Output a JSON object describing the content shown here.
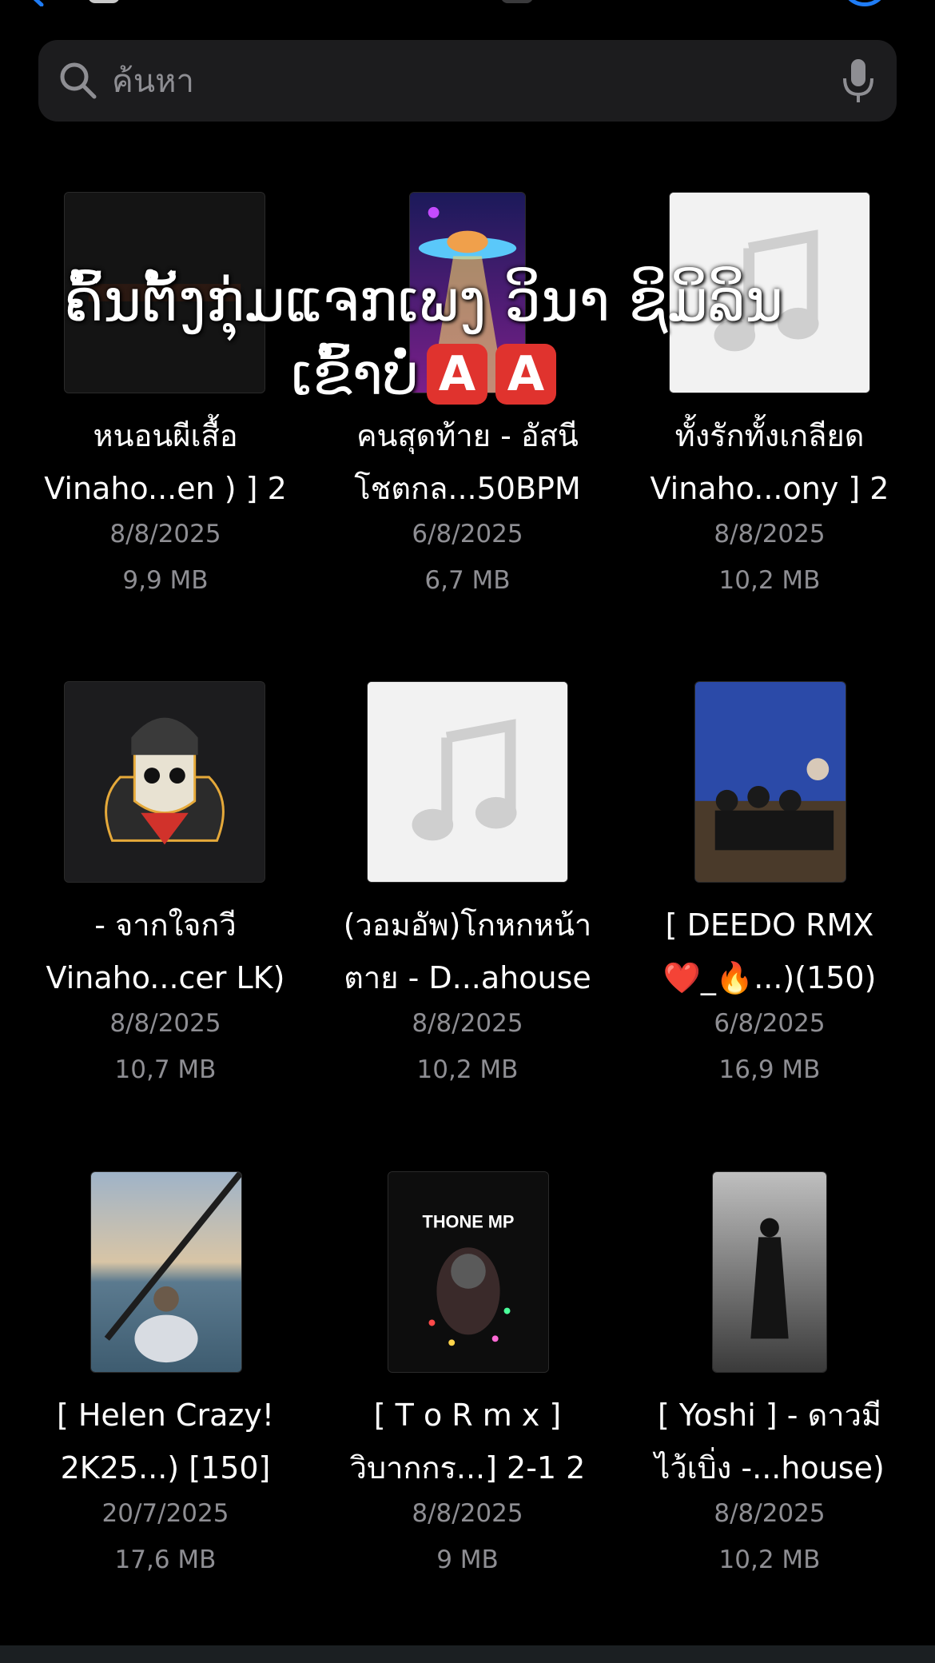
{
  "search": {
    "placeholder": "ค้นหา"
  },
  "overlay": {
    "line1": "ຄົ້ນຕັ້ງກຸ່ມແຈກເພງ ວິນາ ຊິມິລິນ",
    "line2": "ເຂົ້າບໍ່",
    "badge": "A"
  },
  "files": [
    {
      "line1": "หนอนผีเสื้อ",
      "line2": "Vinaho...en ) ] 2",
      "date": "8/8/2025",
      "size": "9,9 MB",
      "thumb": "dark-cover"
    },
    {
      "line1": "คนสุดท้าย - อัสนี",
      "line2": "โชตกล...50BPM",
      "date": "6/8/2025",
      "size": "6,7 MB",
      "thumb": "ufo-cover"
    },
    {
      "line1": "ทั้งรักทั้งเกลียด",
      "line2": "Vinaho...ony ] 2",
      "date": "8/8/2025",
      "size": "10,2 MB",
      "thumb": "music-note-placeholder"
    },
    {
      "line1": "- จากใจกวี",
      "line2": "Vinaho...cer LK)",
      "date": "8/8/2025",
      "size": "10,7 MB",
      "thumb": "skull-cover"
    },
    {
      "line1": "(วอมอัพ)โกหกหน้า",
      "line2": "ตาย - D...ahouse",
      "date": "8/8/2025",
      "size": "10,2 MB",
      "thumb": "music-note-placeholder"
    },
    {
      "line1": "[ DEEDO RMX",
      "line2": "❤️_🔥...)(150)",
      "date": "6/8/2025",
      "size": "16,9 MB",
      "thumb": "group-photo-cover"
    },
    {
      "line1": "[ Helen Crazy!",
      "line2": "2K25...) [150]",
      "date": "20/7/2025",
      "size": "17,6 MB",
      "thumb": "sea-photo-cover"
    },
    {
      "line1": "[ T o R m x ]",
      "line2": "วิบากกร...] 2-1 2",
      "date": "8/8/2025",
      "size": "9 MB",
      "thumb": "astronaut-cover"
    },
    {
      "line1": "[ Yoshi ] - ดาวมี",
      "line2": "ไว้เบิ่ง -...house)",
      "date": "8/8/2025",
      "size": "10,2 MB",
      "thumb": "dark-figure-cover"
    }
  ],
  "thumb_text": {
    "thone": "THONE MP"
  },
  "colors": {
    "accent": "#1f7cf5",
    "background": "#000000",
    "secondary_text": "#8e8e93",
    "search_bg": "#1c1c1e"
  }
}
